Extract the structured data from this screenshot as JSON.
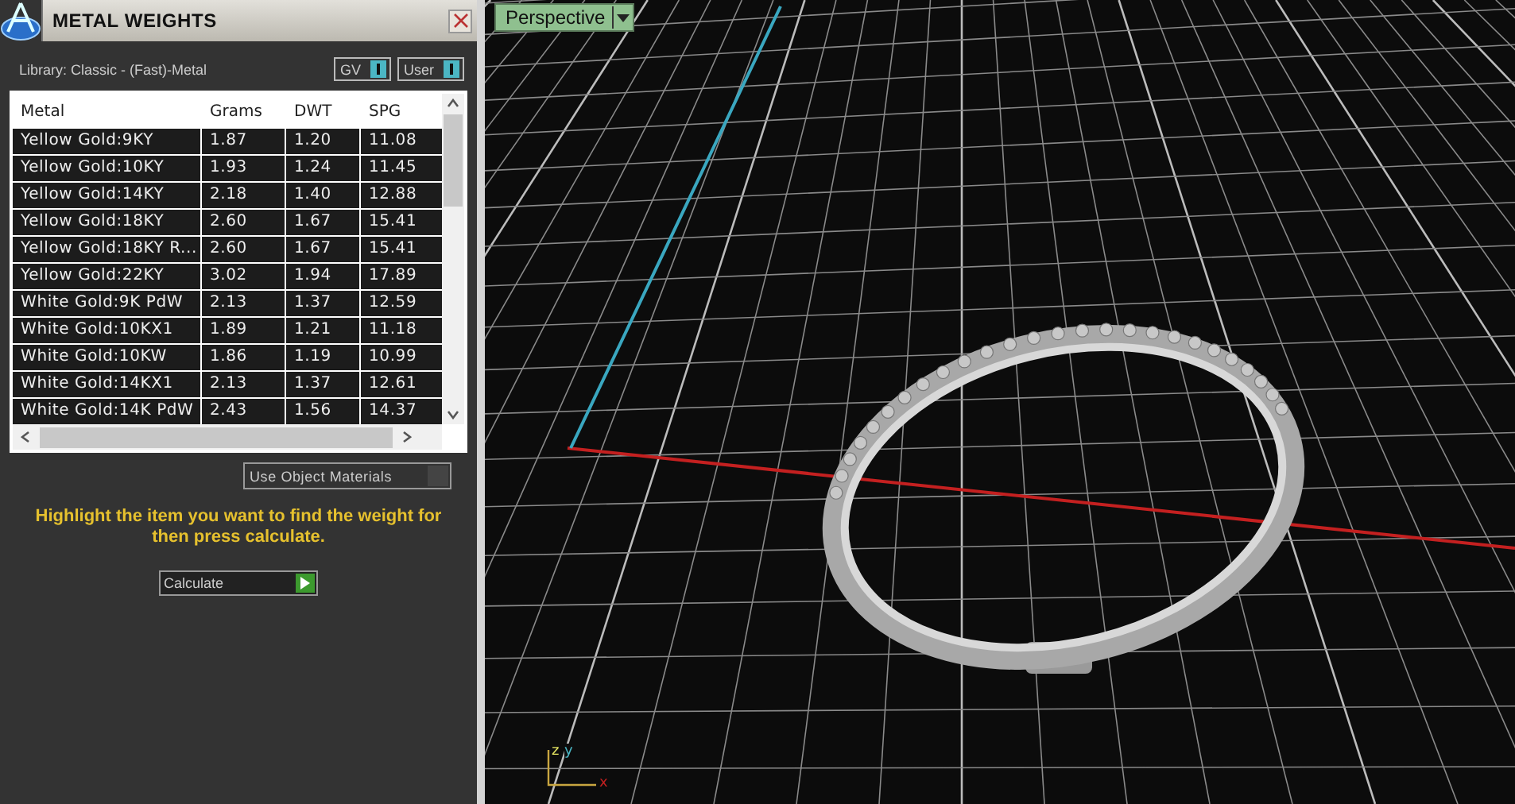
{
  "panel": {
    "title": "METAL WEIGHTS",
    "library": "Library: Classic - (Fast)-Metal",
    "toggles": [
      {
        "label": "GV",
        "on": true
      },
      {
        "label": "User",
        "on": true
      }
    ],
    "table": {
      "columns": [
        "Metal",
        "Grams",
        "DWT",
        "SPG"
      ],
      "rows": [
        [
          "Yellow Gold:9KY",
          "1.87",
          "1.20",
          "11.08"
        ],
        [
          "Yellow Gold:10KY",
          "1.93",
          "1.24",
          "11.45"
        ],
        [
          "Yellow Gold:14KY",
          "2.18",
          "1.40",
          "12.88"
        ],
        [
          "Yellow Gold:18KY",
          "2.60",
          "1.67",
          "15.41"
        ],
        [
          "Yellow Gold:18KY R...",
          "2.60",
          "1.67",
          "15.41"
        ],
        [
          "Yellow Gold:22KY",
          "3.02",
          "1.94",
          "17.89"
        ],
        [
          "White Gold:9K PdW",
          "2.13",
          "1.37",
          "12.59"
        ],
        [
          "White Gold:10KX1",
          "1.89",
          "1.21",
          "11.18"
        ],
        [
          "White Gold:10KW",
          "1.86",
          "1.19",
          "10.99"
        ],
        [
          "White Gold:14KX1",
          "2.13",
          "1.37",
          "12.61"
        ],
        [
          "White Gold:14K PdW",
          "2.43",
          "1.56",
          "14.37"
        ]
      ]
    },
    "use_object_materials": {
      "label": "Use Object Materials",
      "checked": false
    },
    "hint": "Highlight the item you want to find the weight for then press calculate.",
    "calculate_button": "Calculate"
  },
  "viewport": {
    "view_menu": "Perspective",
    "axis_labels": [
      "z",
      "y",
      "x"
    ]
  }
}
